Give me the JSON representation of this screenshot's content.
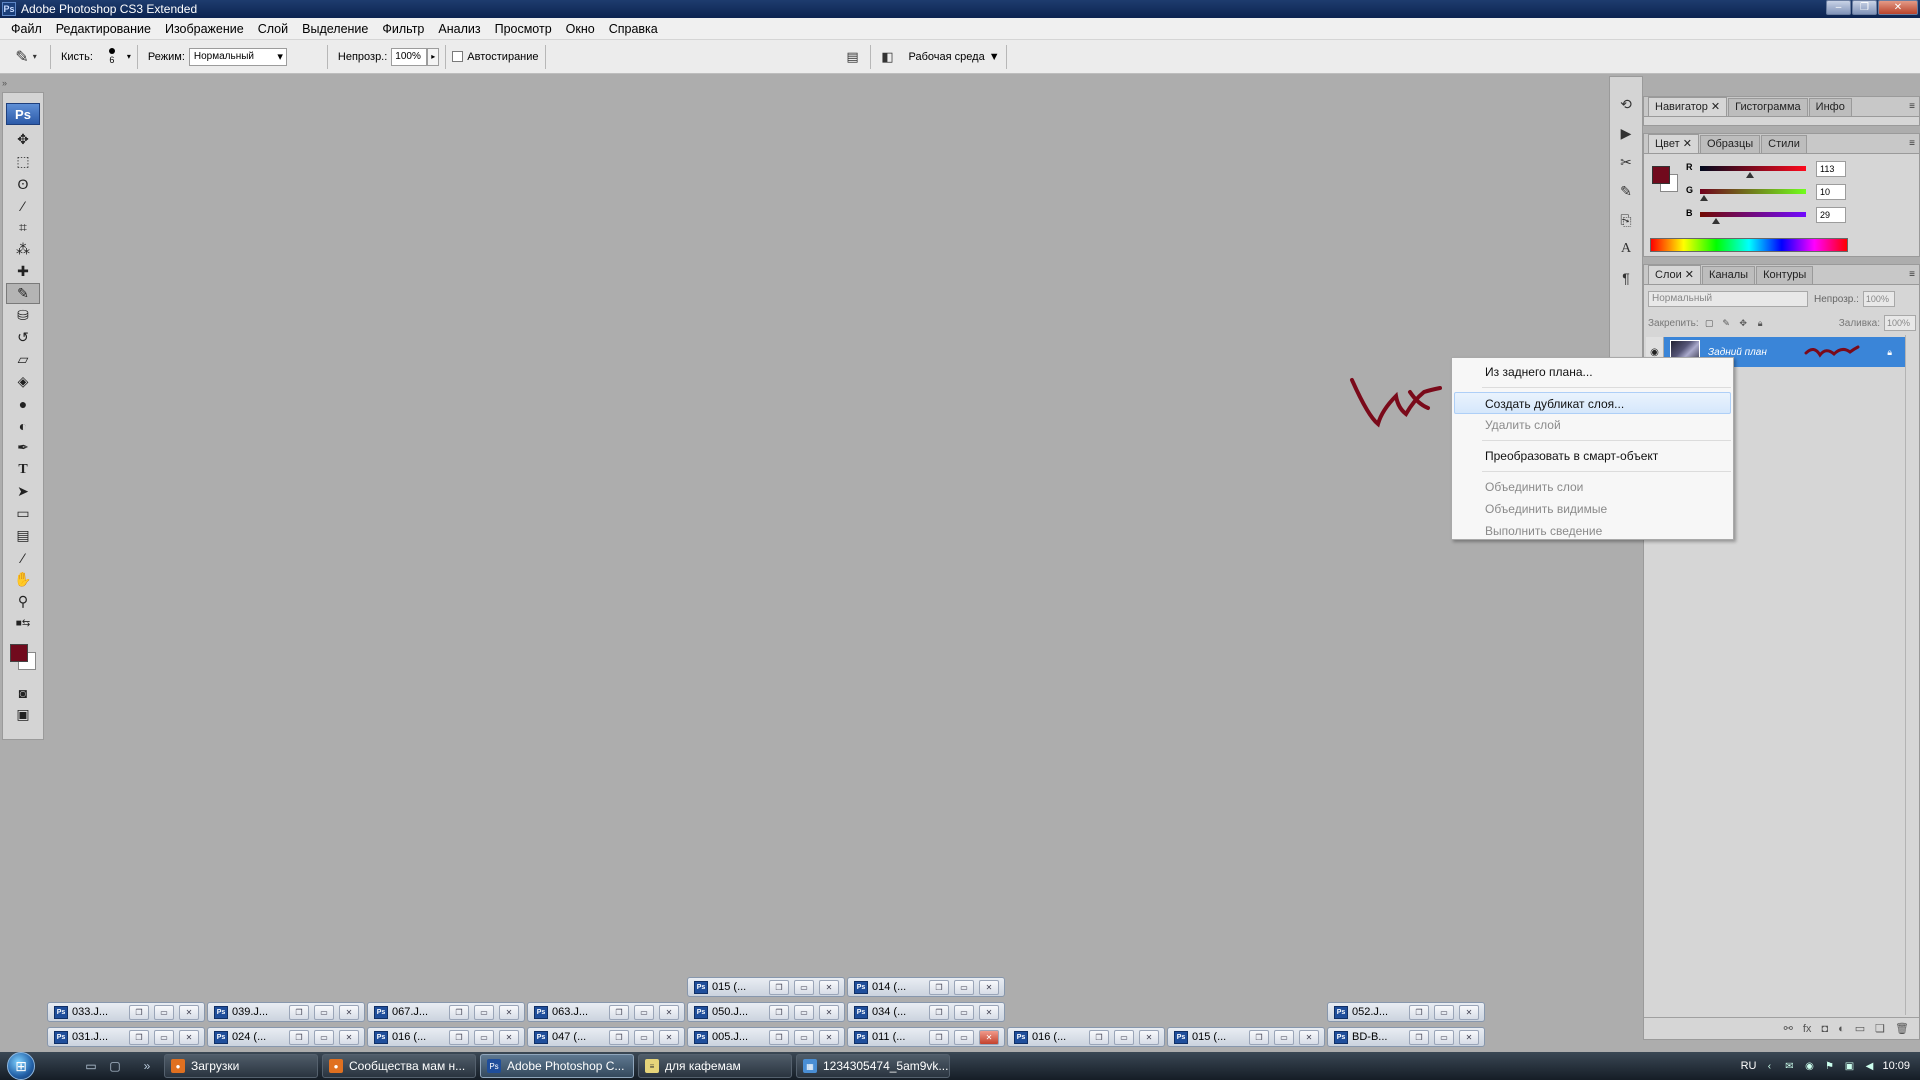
{
  "window": {
    "title": "Adobe Photoshop CS3 Extended",
    "app_badge": "Ps"
  },
  "menu": [
    "Файл",
    "Редактирование",
    "Изображение",
    "Слой",
    "Выделение",
    "Фильтр",
    "Анализ",
    "Просмотр",
    "Окно",
    "Справка"
  ],
  "options": {
    "brush_label": "Кисть:",
    "brush_size": "6",
    "mode_label": "Режим:",
    "mode_value": "Нормальный",
    "opacity_label": "Непрозр.:",
    "opacity_value": "100%",
    "autoerase_label": "Автостирание",
    "workspace_label": "Рабочая среда"
  },
  "tools": {
    "logo": "Ps",
    "items": [
      "move-tool-icon",
      "marquee-tool-icon",
      "lasso-tool-icon",
      "magic-wand-icon",
      "crop-tool-icon",
      "eyedropper-tool-icon",
      "healing-brush-icon",
      "pencil-tool-icon",
      "stamp-tool-icon",
      "history-brush-icon",
      "eraser-tool-icon",
      "paint-bucket-icon",
      "blur-tool-icon",
      "dodge-tool-icon",
      "pen-tool-icon",
      "type-tool-icon",
      "path-select-icon",
      "shape-tool-icon",
      "notes-tool-icon",
      "eyedropper2-icon",
      "hand-tool-icon",
      "zoom-tool-icon"
    ],
    "foreground_color": "#710a1d",
    "background_color": "#ffffff"
  },
  "panels": {
    "nav_tabs": [
      "Навигатор",
      "Гистограмма",
      "Инфо"
    ],
    "color_tabs": [
      "Цвет",
      "Образцы",
      "Стили"
    ],
    "color": {
      "r_label": "R",
      "r_value": "113",
      "g_label": "G",
      "g_value": "10",
      "b_label": "B",
      "b_value": "29"
    },
    "layers_tabs": [
      "Слои",
      "Каналы",
      "Контуры"
    ],
    "layers": {
      "blend_mode": "Нормальный",
      "opacity_label": "Непрозр.:",
      "opacity_value": "100%",
      "lock_label": "Закрепить:",
      "fill_label": "Заливка:",
      "fill_value": "100%",
      "layer_name": "Задний план"
    }
  },
  "context_menu": {
    "items": [
      {
        "label": "Из заднего плана...",
        "disabled": false
      },
      {
        "label": "Создать дубликат слоя...",
        "disabled": false,
        "hover": true
      },
      {
        "label": "Удалить слой",
        "disabled": true
      },
      {
        "label": "Преобразовать в смарт-объект",
        "disabled": false
      },
      {
        "label": "Объединить слои",
        "disabled": true
      },
      {
        "label": "Объединить видимые",
        "disabled": true
      },
      {
        "label": "Выполнить сведение",
        "disabled": true
      }
    ]
  },
  "doc_bars": {
    "row1": [
      "015 (...",
      "014 (..."
    ],
    "row2": [
      "033.J...",
      "039.J...",
      "067.J...",
      "063.J...",
      "050.J...",
      "034 (...",
      "052.J..."
    ],
    "row3": [
      "031.J...",
      "024 (...",
      "016 (...",
      "047 (...",
      "005.J...",
      "011 (...",
      "016 (...",
      "015 (...",
      "BD-B..."
    ]
  },
  "taskbar": {
    "tasks": [
      "Загрузки",
      "Сообщества мам н...",
      "Adobe Photoshop C...",
      "для кафемам",
      "1234305474_5am9vk..."
    ],
    "language": "RU",
    "time": "10:09"
  }
}
